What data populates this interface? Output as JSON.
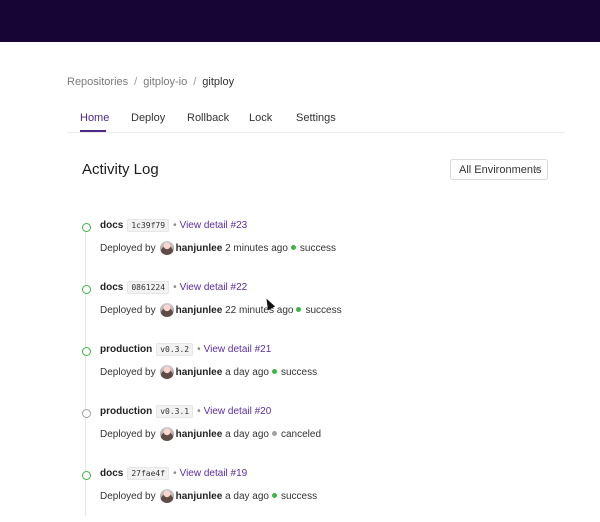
{
  "breadcrumb": {
    "items": [
      "Repositories",
      "gitploy-io",
      "gitploy"
    ],
    "separator": "/"
  },
  "tabs": [
    {
      "label": "Home",
      "active": true
    },
    {
      "label": "Deploy",
      "active": false
    },
    {
      "label": "Rollback",
      "active": false
    },
    {
      "label": "Lock",
      "active": false
    },
    {
      "label": "Settings",
      "active": false
    }
  ],
  "page": {
    "title": "Activity Log"
  },
  "environment_select": {
    "value": "All Environments"
  },
  "activity": [
    {
      "env": "docs",
      "ref": "1c39f79",
      "detail": "View detail #23",
      "prefix": "Deployed by",
      "user": "hanjunlee",
      "time": "2 minutes ago",
      "status": "success",
      "status_color": "#3db543"
    },
    {
      "env": "docs",
      "ref": "0861224",
      "detail": "View detail #22",
      "prefix": "Deployed by",
      "user": "hanjunlee",
      "time": "22 minutes ago",
      "status": "success",
      "status_color": "#3db543"
    },
    {
      "env": "production",
      "ref": "v0.3.2",
      "detail": "View detail #21",
      "prefix": "Deployed by",
      "user": "hanjunlee",
      "time": "a day ago",
      "status": "success",
      "status_color": "#3db543"
    },
    {
      "env": "production",
      "ref": "v0.3.1",
      "detail": "View detail #20",
      "prefix": "Deployed by",
      "user": "hanjunlee",
      "time": "a day ago",
      "status": "canceled",
      "status_color": "#a0a0a0"
    },
    {
      "env": "docs",
      "ref": "27fae4f",
      "detail": "View detail #19",
      "prefix": "Deployed by",
      "user": "hanjunlee",
      "time": "a day ago",
      "status": "success",
      "status_color": "#3db543"
    }
  ],
  "colors": {
    "topbar": "#170536",
    "accent": "#4b2a86",
    "link": "#5a2fa0",
    "success": "#3db543",
    "canceled": "#a0a0a0"
  },
  "icons": {
    "avatar": "user-avatar-icon",
    "select_chevron": "chevron-down-icon"
  }
}
